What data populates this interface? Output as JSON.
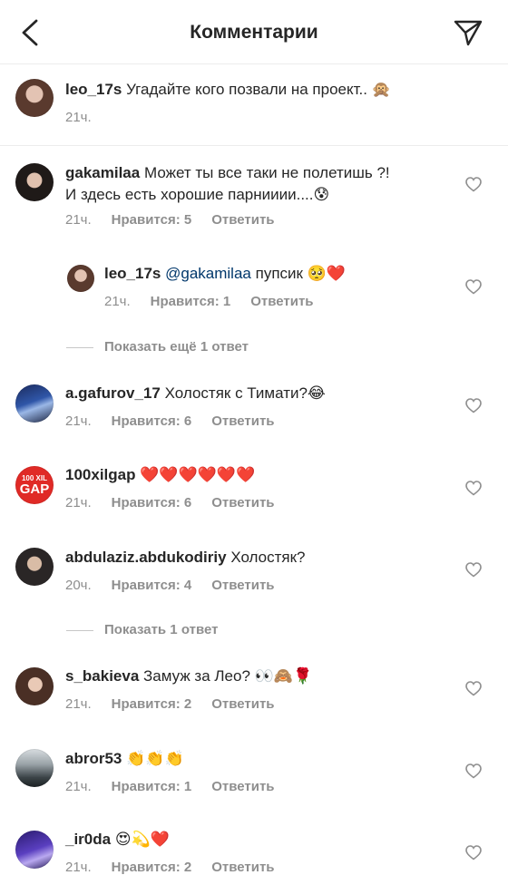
{
  "header": {
    "title": "Комментарии"
  },
  "caption": {
    "username": "leo_17s",
    "text": "Угадайте кого позвали на проект.. 🙊",
    "time": "21ч."
  },
  "comments": [
    {
      "username": "gakamilaa",
      "line1": "Может ты все таки не полетишь ?!",
      "line2": "И здесь есть хорошие парнииии....😰",
      "time": "21ч.",
      "likes": "Нравится: 5",
      "reply": "Ответить"
    },
    {
      "username": "leo_17s",
      "mention": "@gakamilaa",
      "text": "пупсик 🥺❤️",
      "time": "21ч.",
      "likes": "Нравится: 1",
      "reply": "Ответить"
    },
    {
      "username": "a.gafurov_17",
      "text": "Холостяк с Тимати?😂",
      "time": "21ч.",
      "likes": "Нравится: 6",
      "reply": "Ответить"
    },
    {
      "username": "100xilgap",
      "text": "❤️❤️❤️❤️❤️❤️",
      "time": "21ч.",
      "likes": "Нравится: 6",
      "reply": "Ответить"
    },
    {
      "username": "abdulaziz.abdukodiriy",
      "text": "Холостяк?",
      "time": "20ч.",
      "likes": "Нравится: 4",
      "reply": "Ответить"
    },
    {
      "username": "s_bakieva",
      "text": "Замуж за Лео? 👀🙈🌹",
      "time": "21ч.",
      "likes": "Нравится: 2",
      "reply": "Ответить"
    },
    {
      "username": "abror53",
      "text": "👏👏👏",
      "time": "21ч.",
      "likes": "Нравится: 1",
      "reply": "Ответить"
    },
    {
      "username": "_ir0da",
      "text": "😍💫❤️",
      "time": "21ч.",
      "likes": "Нравится: 2",
      "reply": "Ответить"
    }
  ],
  "show_more_1": "Показать ещё 1 ответ",
  "show_more_2": "Показать 1 ответ",
  "avatar_badge": {
    "line1": "100 XIL",
    "line2": "GAP"
  },
  "colors": {
    "text": "#262626",
    "meta": "#8e8e8e",
    "mention": "#00376b",
    "divider": "#ececec"
  }
}
